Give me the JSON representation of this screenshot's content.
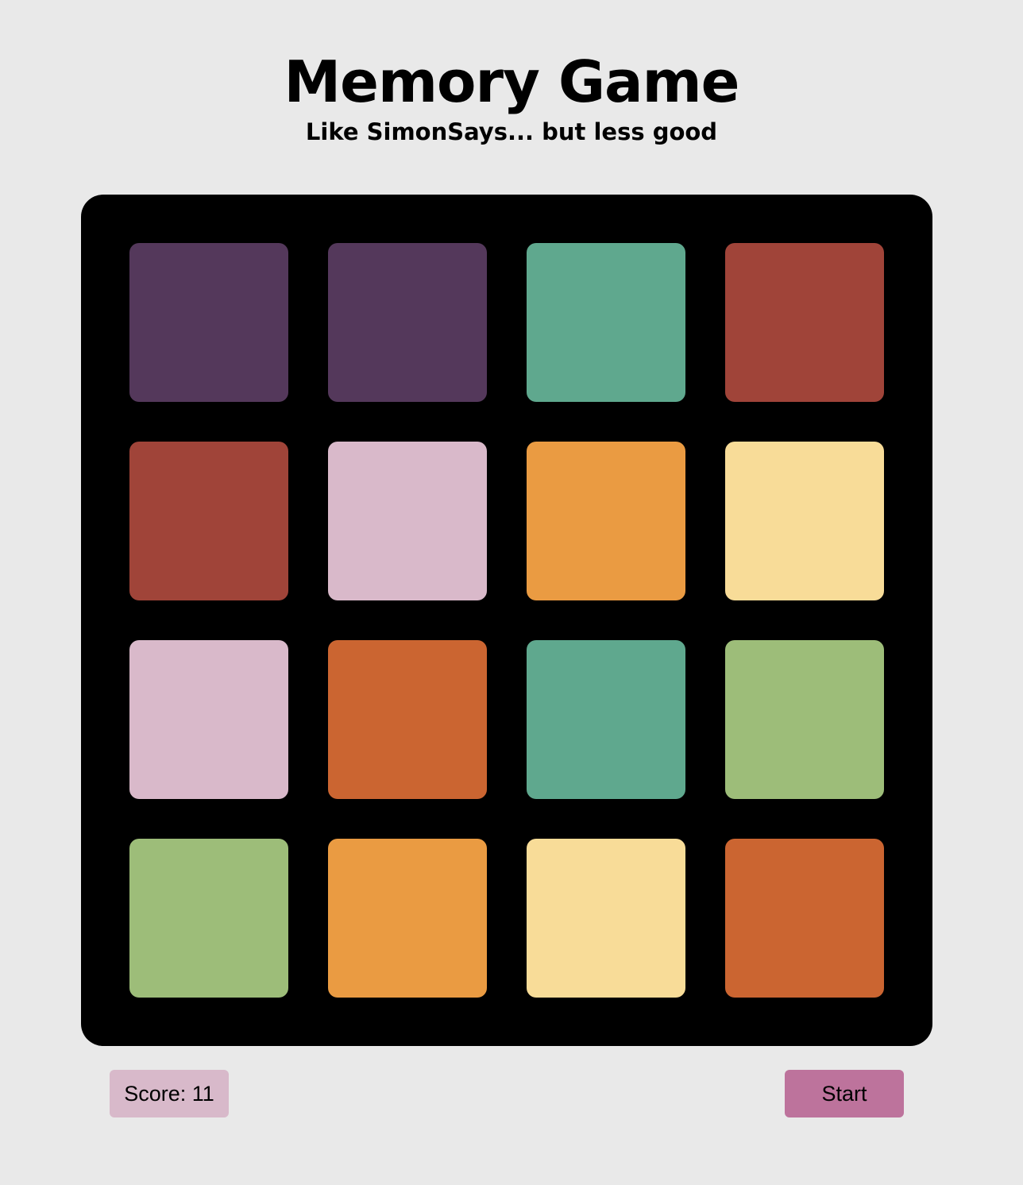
{
  "header": {
    "title": "Memory Game",
    "subtitle": "Like SimonSays... but less good"
  },
  "board": {
    "tiles": [
      {
        "color": "#54385b"
      },
      {
        "color": "#54385b"
      },
      {
        "color": "#5fa88e"
      },
      {
        "color": "#a04439"
      },
      {
        "color": "#a04439"
      },
      {
        "color": "#d9b9ca"
      },
      {
        "color": "#ea9b42"
      },
      {
        "color": "#f8dc98"
      },
      {
        "color": "#d9b9ca"
      },
      {
        "color": "#cb6531"
      },
      {
        "color": "#5fa88e"
      },
      {
        "color": "#9dbd79"
      },
      {
        "color": "#9dbd79"
      },
      {
        "color": "#ea9b42"
      },
      {
        "color": "#f8dc98"
      },
      {
        "color": "#cb6531"
      }
    ]
  },
  "footer": {
    "score_text": "Score: 11",
    "start_label": "Start"
  }
}
